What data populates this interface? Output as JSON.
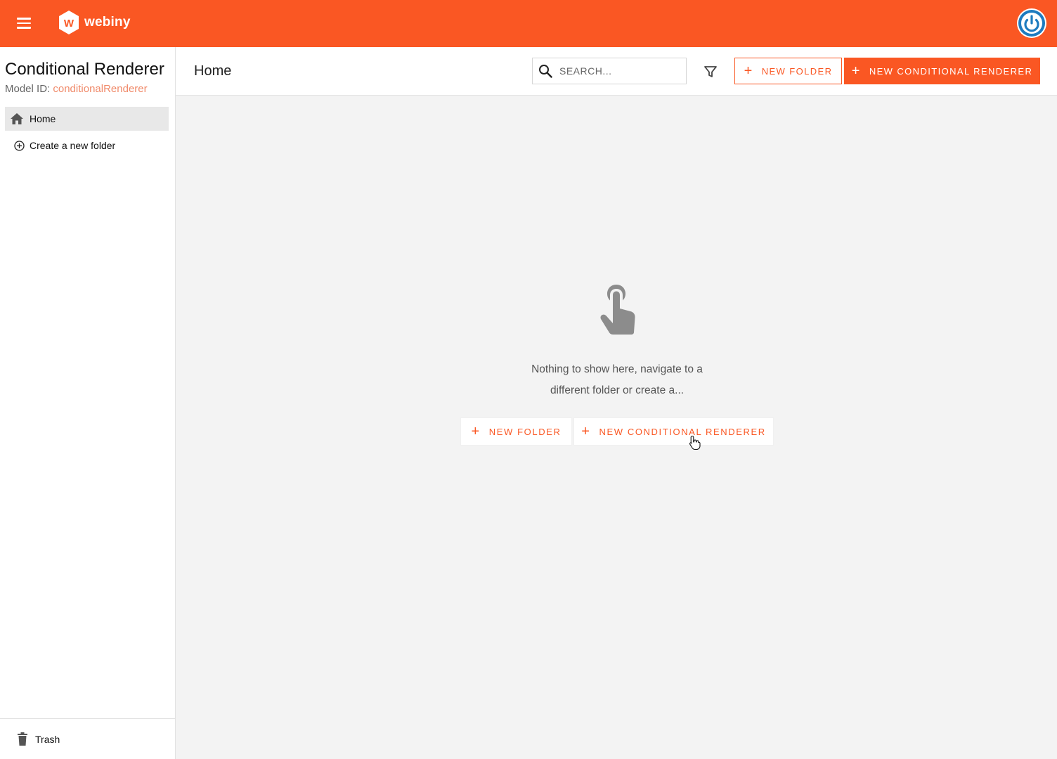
{
  "app": {
    "brand": "webiny",
    "colors": {
      "accent": "#fa5723",
      "avatar_ring": "#1e7bbf"
    }
  },
  "topbar": {
    "menu_icon": "hamburger-icon",
    "avatar_icon": "power-icon"
  },
  "sidebar": {
    "model_title": "Conditional Renderer",
    "model_id_label": "Model ID:",
    "model_id_value": "conditionalRenderer",
    "home_label": "Home",
    "create_folder_label": "Create a new folder",
    "trash_label": "Trash"
  },
  "header": {
    "title": "Home",
    "search_placeholder": "SEARCH...",
    "new_folder_label": "NEW FOLDER",
    "new_entry_label": "NEW CONDITIONAL RENDERER"
  },
  "empty_state": {
    "message": "Nothing to show here, navigate to a different folder or create a...",
    "new_folder_label": "NEW FOLDER",
    "new_entry_label": "NEW CONDITIONAL RENDERER",
    "icon": "touch-hand-icon"
  }
}
